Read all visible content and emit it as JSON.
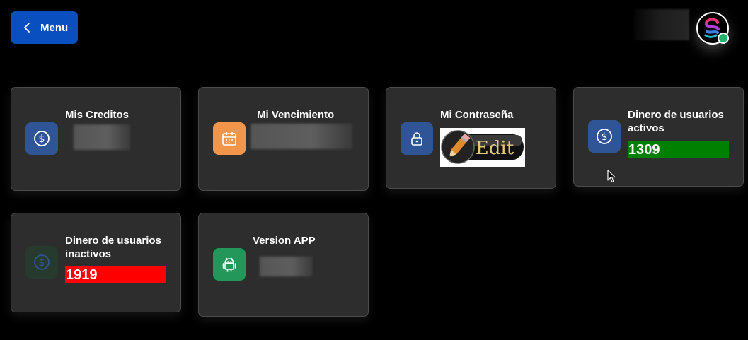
{
  "header": {
    "menu_label": "Menu"
  },
  "cards": {
    "creditos": {
      "title": "Mis Creditos"
    },
    "vencimiento": {
      "title": "Mi Vencimiento"
    },
    "contrasena": {
      "title": "Mi Contraseña",
      "edit_label": "Edit"
    },
    "activos": {
      "title": "Dinero de usuarios activos",
      "value": "1309",
      "bar_color": "#008000"
    },
    "inactivos": {
      "title": "Dinero de usuarios inactivos",
      "value": "1919",
      "bar_color": "#ff0000"
    },
    "version": {
      "title": "Version APP"
    }
  },
  "icons": {
    "dollar": "dollar-circle-icon",
    "calendar": "calendar-icon",
    "lock": "lock-icon",
    "android": "android-icon",
    "chevron": "chevron-left-icon"
  },
  "colors": {
    "menu_blue": "#0a4fbf",
    "icon_blue": "#2f5596",
    "icon_orange": "#f0954a",
    "icon_green": "#23975a",
    "icon_darkgreen": "#263b2d",
    "card_bg": "#2d2d2d"
  }
}
